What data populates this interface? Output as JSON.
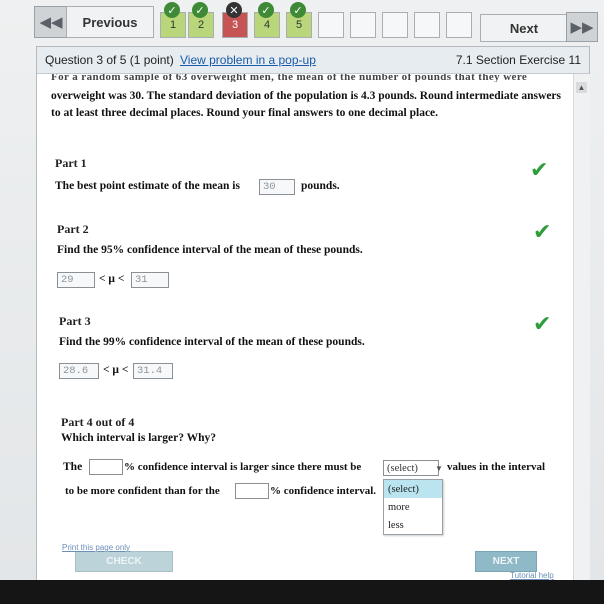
{
  "nav": {
    "previous_label": "Previous",
    "next_label": "Next",
    "questions": [
      {
        "number": "1",
        "status": "correct"
      },
      {
        "number": "2",
        "status": "correct"
      },
      {
        "number": "3",
        "status": "current"
      },
      {
        "number": "4",
        "status": "correct"
      },
      {
        "number": "5",
        "status": "correct"
      }
    ],
    "status_icons": {
      "correct": "check-icon",
      "incorrect": "x-icon"
    }
  },
  "header": {
    "question_of": "Question 3 of 5 (1 point)",
    "popup_link": "View problem in a pop-up",
    "section": "7.1 Section Exercise 11"
  },
  "problem": {
    "cut_line": "For a random sample of 63 overweight men, the mean of the number of pounds that they were",
    "text": "overweight was 30. The standard deviation of the population is 4.3 pounds. Round intermediate answers to at least three decimal places. Round your final answers to one decimal place."
  },
  "part1": {
    "title": "Part 1",
    "question": "The best point estimate of the mean is",
    "answer": "30",
    "unit": "pounds."
  },
  "part2": {
    "title": "Part 2",
    "question": "Find the 95% confidence interval of the mean of these pounds.",
    "lower": "29",
    "mu_text": "< μ <",
    "upper": "31"
  },
  "part3": {
    "title": "Part 3",
    "question": "Find the 99% confidence interval of the mean of these pounds.",
    "lower": "28.6",
    "mu_text": "< μ <",
    "upper": "31.4"
  },
  "part4": {
    "title": "Part 4 out of 4",
    "question": "Which interval is larger? Why?",
    "line1_prefix": "The",
    "line1_mid": "% confidence interval is larger since there must be",
    "select_value": "(select)",
    "line1_suffix": "values in the interval",
    "line2_prefix": "to be more confident than for the",
    "line2_mid": "% confidence interval.",
    "options": [
      "(select)",
      "more",
      "less"
    ]
  },
  "buttons": {
    "check": "CHECK",
    "next": "NEXT"
  },
  "footer": {
    "print": "Print this page only",
    "tutorial": "Tutorial help"
  }
}
